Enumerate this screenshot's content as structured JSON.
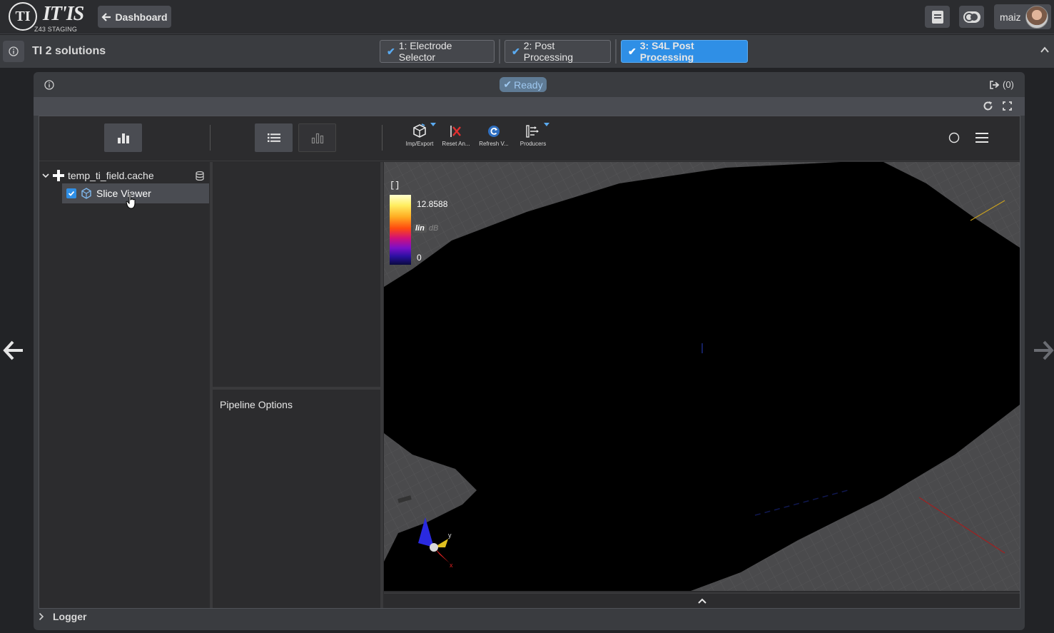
{
  "topbar": {
    "logo_initials": "TI",
    "logo_brand": "IT'IS",
    "logo_subtitle": "Z43 STAGING",
    "dashboard_label": "Dashboard",
    "user_name": "maiz"
  },
  "study": {
    "title": "TI 2 solutions",
    "steps": [
      {
        "label": "1: Electrode Selector",
        "active": false
      },
      {
        "label": "2: Post Processing",
        "active": false
      },
      {
        "label": "3: S4L Post Processing",
        "active": true
      }
    ]
  },
  "node": {
    "status": "Ready",
    "outputs_label": "(0)"
  },
  "toolbar": {
    "tools": [
      {
        "label": "Imp/Export",
        "icon": "import-export-icon",
        "has_menu": true
      },
      {
        "label": "Reset An...",
        "icon": "reset-icon",
        "has_menu": false
      },
      {
        "label": "Refresh V...",
        "icon": "refresh-view-icon",
        "has_menu": false
      },
      {
        "label": "Producers",
        "icon": "producers-icon",
        "has_menu": true
      }
    ]
  },
  "tree": {
    "root_label": "temp_ti_field.cache",
    "child_label": "Slice Viewer",
    "child_checked": true
  },
  "pipeline": {
    "title": "Pipeline Options"
  },
  "viewer": {
    "colorbar_unit": "[]",
    "colorbar_max": "12.8588",
    "colorbar_min": "0",
    "scale_lin": "lin",
    "scale_db": "dB",
    "axis_y": "y",
    "axis_x": "x"
  },
  "logger": {
    "label": "Logger"
  },
  "colors": {
    "accent": "#2f8fe6",
    "panel": "#3a3c40",
    "background": "#222326"
  }
}
